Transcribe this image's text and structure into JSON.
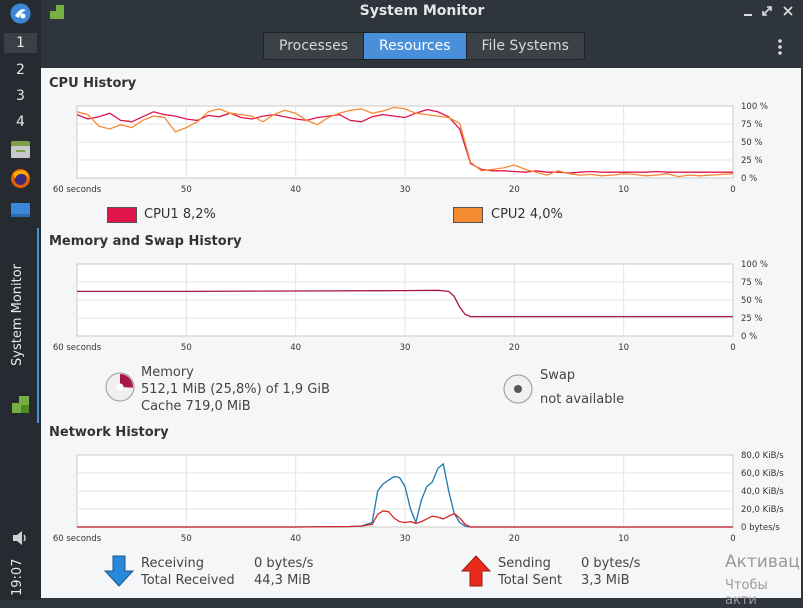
{
  "window": {
    "title": "System Monitor",
    "buttons": [
      "minimize-icon",
      "restore-icon",
      "close-icon"
    ]
  },
  "dock": {
    "workspaces": [
      "1",
      "2",
      "3",
      "4"
    ],
    "active_workspace": "1",
    "apps": [
      "file-manager-icon",
      "firefox-icon",
      "desktop-icon"
    ],
    "active_window_label": "System Monitor",
    "clock": "19:07"
  },
  "tabs": [
    {
      "label": "Processes",
      "active": false
    },
    {
      "label": "Resources",
      "active": true
    },
    {
      "label": "File Systems",
      "active": false
    }
  ],
  "sections": {
    "cpu": "CPU History",
    "memory": "Memory and Swap History",
    "network": "Network History"
  },
  "cpu_legend": [
    {
      "name": "CPU1",
      "value": "8,2%",
      "color": "#e0154a"
    },
    {
      "name": "CPU2",
      "value": "4,0%",
      "color": "#f48a32"
    }
  ],
  "memory": {
    "label": "Memory",
    "usage": "512,1 MiB (25,8%) of 1,9 GiB",
    "cache": "Cache 719,0 MiB",
    "color": "#a8174b",
    "fraction": 0.258
  },
  "swap": {
    "label": "Swap",
    "status": "not available"
  },
  "network": {
    "receiving_label": "Receiving",
    "receiving_value": "0 bytes/s",
    "total_received_label": "Total Received",
    "total_received_value": "44,3 MiB",
    "sending_label": "Sending",
    "sending_value": "0 bytes/s",
    "total_sent_label": "Total Sent",
    "total_sent_value": "3,3 MiB",
    "receiving_color": "#1f77b4",
    "sending_color": "#d62728"
  },
  "watermark": {
    "line1": "Активац",
    "line2": "Чтобы акти"
  },
  "chart_data": [
    {
      "type": "line",
      "title": "CPU History",
      "x_ticks": [
        "60 seconds",
        "50",
        "40",
        "30",
        "20",
        "10",
        "0"
      ],
      "y_ticks": [
        "100 %",
        "75 %",
        "50 %",
        "25 %",
        "0 %"
      ],
      "ylim": [
        0,
        100
      ],
      "x": [
        60,
        59,
        58,
        57,
        56,
        55,
        54,
        53,
        52,
        51,
        50,
        49,
        48,
        47,
        46,
        45,
        44,
        43,
        42,
        41,
        40,
        39,
        38,
        37,
        36,
        35,
        34,
        33,
        32,
        31,
        30,
        29,
        28,
        27,
        26,
        25,
        24,
        23,
        22,
        21,
        20,
        19,
        18,
        17,
        16,
        15,
        14,
        13,
        12,
        11,
        10,
        9,
        8,
        7,
        6,
        5,
        4,
        3,
        2,
        1,
        0
      ],
      "series": [
        {
          "name": "CPU1",
          "color": "#e0154a",
          "values": [
            88,
            82,
            85,
            90,
            80,
            78,
            85,
            92,
            88,
            86,
            82,
            80,
            87,
            85,
            90,
            84,
            82,
            86,
            88,
            85,
            82,
            80,
            84,
            86,
            88,
            80,
            78,
            85,
            88,
            86,
            84,
            90,
            95,
            92,
            85,
            68,
            20,
            12,
            10,
            10,
            9,
            8,
            10,
            8,
            8,
            7,
            8,
            9,
            8,
            8,
            8,
            8,
            8,
            9,
            8,
            8,
            8,
            8,
            8,
            8,
            8
          ]
        },
        {
          "name": "CPU2",
          "color": "#f48a32",
          "values": [
            92,
            88,
            72,
            68,
            74,
            70,
            80,
            86,
            84,
            64,
            70,
            78,
            92,
            96,
            90,
            88,
            86,
            78,
            88,
            94,
            90,
            80,
            74,
            84,
            90,
            94,
            96,
            90,
            93,
            98,
            96,
            90,
            88,
            86,
            84,
            76,
            22,
            10,
            12,
            14,
            18,
            12,
            8,
            4,
            10,
            6,
            4,
            5,
            3,
            4,
            6,
            5,
            3,
            4,
            6,
            2,
            4,
            3,
            4,
            5,
            6
          ]
        }
      ]
    },
    {
      "type": "line",
      "title": "Memory and Swap History",
      "x_ticks": [
        "60 seconds",
        "50",
        "40",
        "30",
        "20",
        "10",
        "0"
      ],
      "y_ticks": [
        "100 %",
        "75 %",
        "50 %",
        "25 %",
        "0 %"
      ],
      "ylim": [
        0,
        100
      ],
      "x": [
        60,
        50,
        40,
        30,
        27,
        26,
        25.5,
        25,
        24.5,
        24,
        20,
        10,
        0
      ],
      "series": [
        {
          "name": "Memory",
          "color": "#a8174b",
          "values": [
            62,
            62,
            62.5,
            63,
            63.5,
            62,
            55,
            40,
            30,
            27,
            27,
            27,
            27
          ]
        }
      ]
    },
    {
      "type": "line",
      "title": "Network History",
      "x_ticks": [
        "60 seconds",
        "50",
        "40",
        "30",
        "20",
        "10",
        "0"
      ],
      "y_ticks": [
        "80,0 KiB/s",
        "60,0 KiB/s",
        "40,0 KiB/s",
        "20,0 KiB/s",
        "0 bytes/s"
      ],
      "ylim": [
        0,
        80
      ],
      "x": [
        60,
        40,
        35,
        34,
        33,
        32.5,
        32,
        31.5,
        31,
        30.5,
        30,
        29.5,
        29,
        28.5,
        28,
        27.5,
        27,
        26.5,
        26,
        25.5,
        25,
        24.5,
        24,
        20,
        10,
        0
      ],
      "series": [
        {
          "name": "Receiving",
          "color": "#1f77b4",
          "values": [
            0,
            0,
            0.5,
            1,
            5,
            40,
            48,
            52,
            56,
            55,
            45,
            20,
            5,
            30,
            45,
            50,
            65,
            70,
            40,
            15,
            5,
            1,
            0,
            0,
            0,
            0
          ]
        },
        {
          "name": "Sending",
          "color": "#d62728",
          "values": [
            0,
            0,
            0.5,
            1,
            3,
            14,
            18,
            17,
            10,
            6,
            5,
            6,
            4,
            6,
            9,
            12,
            11,
            9,
            12,
            15,
            10,
            3,
            0,
            0,
            0,
            0
          ]
        }
      ]
    }
  ]
}
